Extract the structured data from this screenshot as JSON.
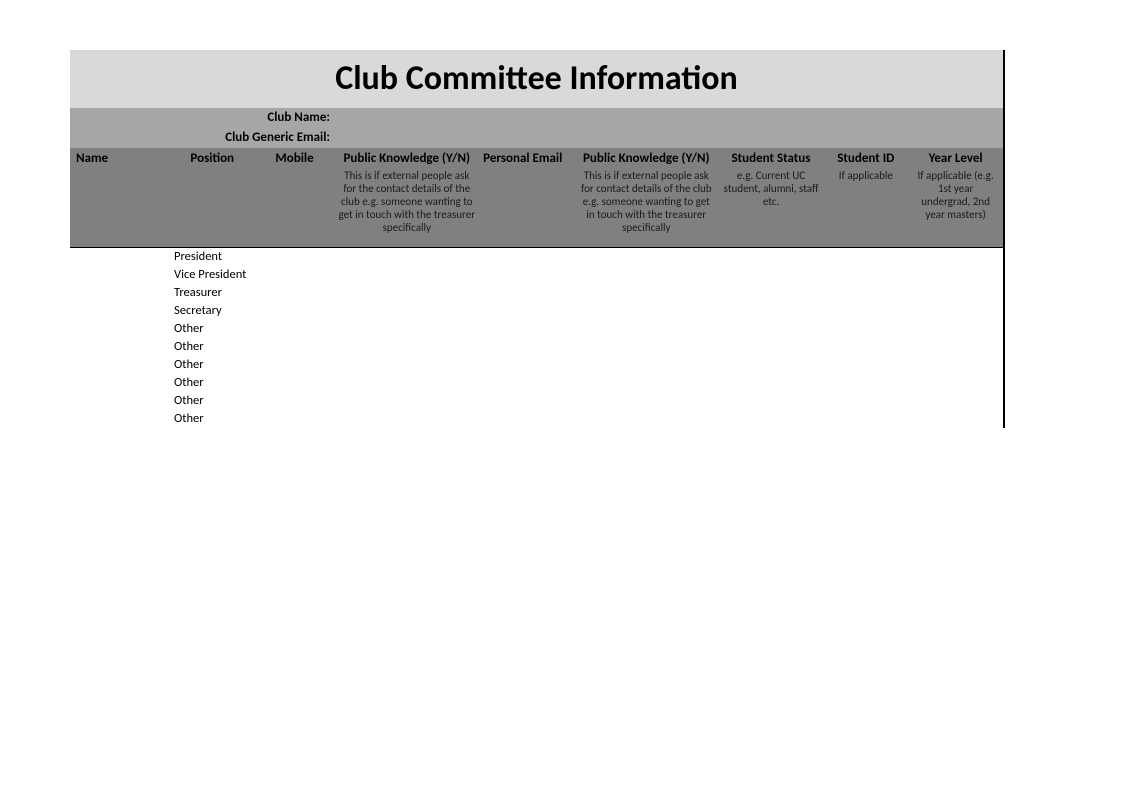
{
  "title": "Club Committee Information",
  "meta": {
    "club_name_label": "Club Name:",
    "club_email_label": "Club Generic Email:"
  },
  "columns": {
    "name": {
      "head": "Name",
      "desc": ""
    },
    "pos": {
      "head": "Position",
      "desc": ""
    },
    "mob": {
      "head": "Mobile",
      "desc": ""
    },
    "pk1": {
      "head": "Public Knowledge (Y/N)",
      "desc": "This is if external people ask for the contact details of the club e.g. someone wanting to get in touch with the treasurer specifically"
    },
    "email": {
      "head": "Personal Email",
      "desc": ""
    },
    "pk2": {
      "head": "Public Knowledge (Y/N)",
      "desc": "This is if external people ask for contact details of the club e.g. someone wanting to get in touch with the treasurer specifically"
    },
    "status": {
      "head": "Student Status",
      "desc": "e.g. Current UC student, alumni, staff etc."
    },
    "id": {
      "head": "Student ID",
      "desc": "If applicable"
    },
    "year": {
      "head": "Year Level",
      "desc": "If applicable (e.g. 1st year undergrad, 2nd year masters)"
    }
  },
  "rows": [
    {
      "position": "President"
    },
    {
      "position": "Vice President"
    },
    {
      "position": "Treasurer"
    },
    {
      "position": "Secretary"
    },
    {
      "position": "Other"
    },
    {
      "position": "Other"
    },
    {
      "position": "Other"
    },
    {
      "position": "Other"
    },
    {
      "position": "Other"
    },
    {
      "position": "Other"
    }
  ]
}
